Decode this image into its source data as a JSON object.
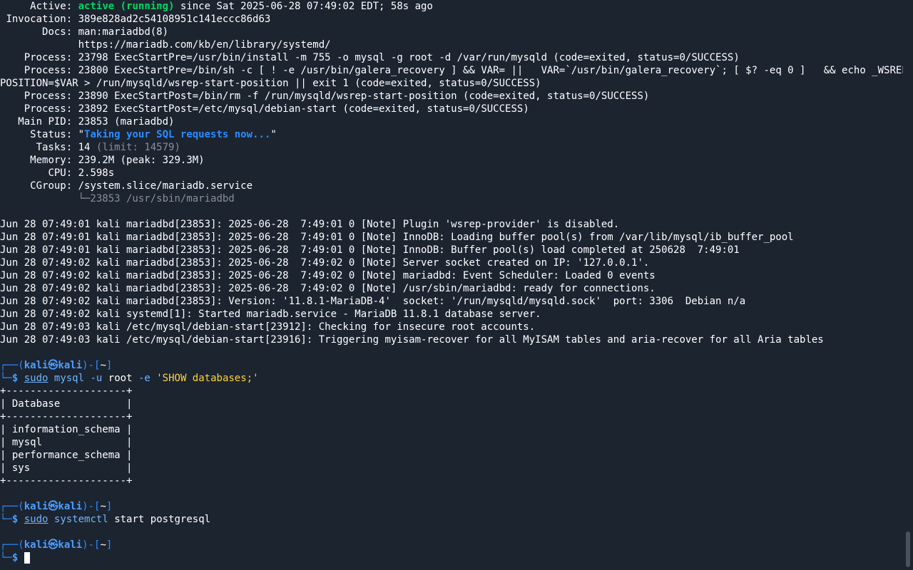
{
  "service": {
    "active_label": "Active:",
    "active_state": "active (running)",
    "active_since": " since Sat 2025-06-28 07:49:02 EDT; 58s ago",
    "invocation_label": "Invocation:",
    "invocation_value": "389e828ad2c54108951c141eccc86d63",
    "docs_label": "Docs:",
    "docs_1": "man:mariadbd(8)",
    "docs_2": "https://mariadb.com/kb/en/library/systemd/",
    "process_label": "Process:",
    "process_1": "23798 ExecStartPre=/usr/bin/install -m 755 -o mysql -g root -d /var/run/mysqld (code=exited, status=0/SUCCESS)",
    "process_2a": "23800 ExecStartPre=/bin/sh -c [ ! -e /usr/bin/galera_recovery ] && VAR= ||   VAR=`/usr/bin/galera_recovery`; [ $? -eq 0 ]   && echo _WSREP_START_",
    "process_2b": "POSITION=$VAR > /run/mysqld/wsrep-start-position || exit 1 (code=exited, status=0/SUCCESS)",
    "process_3": "23890 ExecStartPost=/bin/rm -f /run/mysqld/wsrep-start-position (code=exited, status=0/SUCCESS)",
    "process_4": "23892 ExecStartPost=/etc/mysql/debian-start (code=exited, status=0/SUCCESS)",
    "mainpid_label": "Main PID:",
    "mainpid_value": "23853 (mariadbd)",
    "status_label": "Status:",
    "status_value": "Taking your SQL requests now...",
    "tasks_label": "Tasks:",
    "tasks_value": "14",
    "tasks_limit": "(limit: 14579)",
    "memory_label": "Memory:",
    "memory_value": "239.2M (peak: 329.3M)",
    "cpu_label": "CPU:",
    "cpu_value": "2.598s",
    "cgroup_label": "CGroup:",
    "cgroup_value": "/system.slice/mariadb.service",
    "cgroup_child": "└─23853 /usr/sbin/mariadbd"
  },
  "journal": [
    "Jun 28 07:49:01 kali mariadbd[23853]: 2025-06-28  7:49:01 0 [Note] Plugin 'wsrep-provider' is disabled.",
    "Jun 28 07:49:01 kali mariadbd[23853]: 2025-06-28  7:49:01 0 [Note] InnoDB: Loading buffer pool(s) from /var/lib/mysql/ib_buffer_pool",
    "Jun 28 07:49:01 kali mariadbd[23853]: 2025-06-28  7:49:01 0 [Note] InnoDB: Buffer pool(s) load completed at 250628  7:49:01",
    "Jun 28 07:49:02 kali mariadbd[23853]: 2025-06-28  7:49:02 0 [Note] Server socket created on IP: '127.0.0.1'.",
    "Jun 28 07:49:02 kali mariadbd[23853]: 2025-06-28  7:49:02 0 [Note] mariadbd: Event Scheduler: Loaded 0 events",
    "Jun 28 07:49:02 kali mariadbd[23853]: 2025-06-28  7:49:02 0 [Note] /usr/sbin/mariadbd: ready for connections.",
    "Jun 28 07:49:02 kali mariadbd[23853]: Version: '11.8.1-MariaDB-4'  socket: '/run/mysqld/mysqld.sock'  port: 3306  Debian n/a",
    "Jun 28 07:49:02 kali systemd[1]: Started mariadb.service - MariaDB 11.8.1 database server.",
    "Jun 28 07:49:03 kali /etc/mysql/debian-start[23912]: Checking for insecure root accounts.",
    "Jun 28 07:49:03 kali /etc/mysql/debian-start[23916]: Triggering myisam-recover for all MyISAM tables and aria-recover for all Aria tables"
  ],
  "prompt": {
    "open": "┌──(",
    "user_host": "kali㉿kali",
    "close": ")-[",
    "dir": "~",
    "end": "]",
    "corner": "└─",
    "symbol": "$"
  },
  "commands": {
    "cmd1_sudo": "sudo",
    "cmd1_prog": "mysql",
    "cmd1_flag1": "-u",
    "cmd1_user": "root",
    "cmd1_flag2": "-e",
    "cmd1_query": "'SHOW databases;'",
    "cmd2_sudo": "sudo",
    "cmd2_prog": "systemctl",
    "cmd2_rest": "start postgresql"
  },
  "db_table": {
    "border": "+--------------------+",
    "header": "| Database           |",
    "rows": [
      "| information_schema |",
      "| mysql              |",
      "| performance_schema |",
      "| sys                |"
    ]
  }
}
